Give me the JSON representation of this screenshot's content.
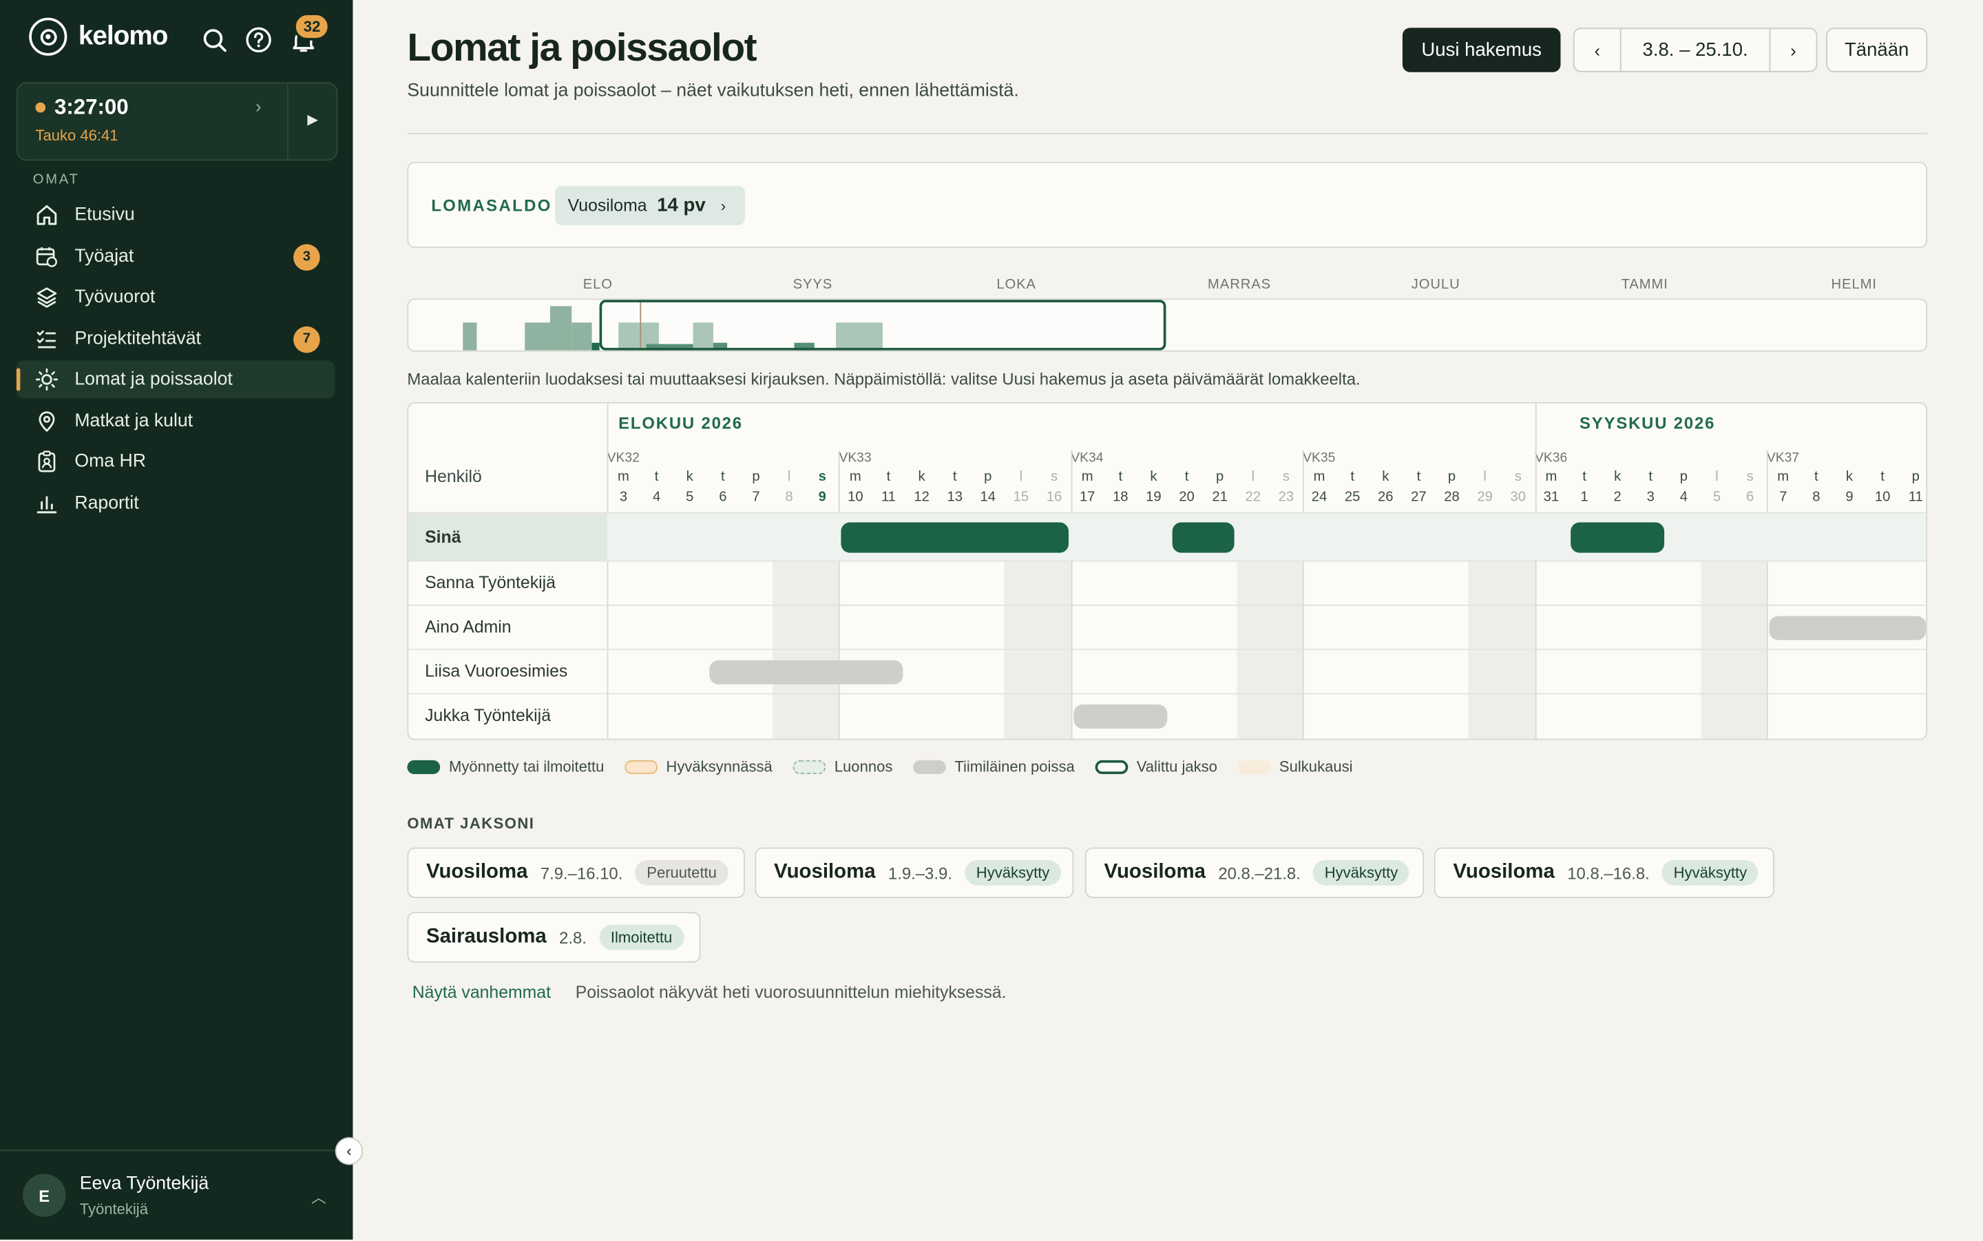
{
  "app": {
    "name": "kelomo",
    "notifications": "32"
  },
  "timer": {
    "time": "3:27:00",
    "pause": "Tauko 46:41"
  },
  "sidebar": {
    "section": "OMAT",
    "items": [
      {
        "label": "Etusivu",
        "icon": "home-icon"
      },
      {
        "label": "Työajat",
        "icon": "calendar-clock-icon",
        "badge": "3"
      },
      {
        "label": "Työvuorot",
        "icon": "layers-icon"
      },
      {
        "label": "Projektitehtävät",
        "icon": "checklist-icon",
        "badge": "7"
      },
      {
        "label": "Lomat ja poissaolot",
        "icon": "sun-icon",
        "active": true
      },
      {
        "label": "Matkat ja kulut",
        "icon": "map-pin-icon"
      },
      {
        "label": "Oma HR",
        "icon": "clipboard-icon"
      },
      {
        "label": "Raportit",
        "icon": "bar-chart-icon"
      }
    ]
  },
  "user": {
    "initial": "E",
    "name": "Eeva Työntekijä",
    "role": "Työntekijä"
  },
  "header": {
    "title": "Lomat ja poissaolot",
    "subtitle": "Suunnittele lomat ja poissaolot – näet vaikutuksen heti, ennen lähettämistä.",
    "new_button": "Uusi hakemus",
    "range": "3.8. – 25.10.",
    "today_button": "Tänään"
  },
  "balance": {
    "label": "LOMASALDO",
    "type": "Vuosiloma",
    "value": "14 pv"
  },
  "timeline": {
    "months": [
      "ELO",
      "SYYS",
      "LOKA",
      "MARRAS",
      "JOULU",
      "TAMMI",
      "HELMI"
    ]
  },
  "hint": "Maalaa kalenteriin luodaksesi tai muuttaaksesi kirjauksen. Näppäimistöllä: valitse Uusi hakemus ja aseta päivämäärät lomakkeelta.",
  "calendar": {
    "months": [
      "ELOKUU 2026",
      "SYYSKUU 2026"
    ],
    "person_header": "Henkilö",
    "weeks": [
      "VK32",
      "VK33",
      "VK34",
      "VK35",
      "VK36",
      "VK37"
    ],
    "days": [
      {
        "l": "m",
        "n": "3"
      },
      {
        "l": "t",
        "n": "4"
      },
      {
        "l": "k",
        "n": "5"
      },
      {
        "l": "t",
        "n": "6"
      },
      {
        "l": "p",
        "n": "7"
      },
      {
        "l": "l",
        "n": "8"
      },
      {
        "l": "s",
        "n": "9"
      },
      {
        "l": "m",
        "n": "10"
      },
      {
        "l": "t",
        "n": "11"
      },
      {
        "l": "k",
        "n": "12"
      },
      {
        "l": "t",
        "n": "13"
      },
      {
        "l": "p",
        "n": "14"
      },
      {
        "l": "l",
        "n": "15"
      },
      {
        "l": "s",
        "n": "16"
      },
      {
        "l": "m",
        "n": "17"
      },
      {
        "l": "t",
        "n": "18"
      },
      {
        "l": "k",
        "n": "19"
      },
      {
        "l": "t",
        "n": "20"
      },
      {
        "l": "p",
        "n": "21"
      },
      {
        "l": "l",
        "n": "22"
      },
      {
        "l": "s",
        "n": "23"
      },
      {
        "l": "m",
        "n": "24"
      },
      {
        "l": "t",
        "n": "25"
      },
      {
        "l": "k",
        "n": "26"
      },
      {
        "l": "t",
        "n": "27"
      },
      {
        "l": "p",
        "n": "28"
      },
      {
        "l": "l",
        "n": "29"
      },
      {
        "l": "s",
        "n": "30"
      },
      {
        "l": "m",
        "n": "31"
      },
      {
        "l": "t",
        "n": "1"
      },
      {
        "l": "k",
        "n": "2"
      },
      {
        "l": "t",
        "n": "3"
      },
      {
        "l": "p",
        "n": "4"
      },
      {
        "l": "l",
        "n": "5"
      },
      {
        "l": "s",
        "n": "6"
      },
      {
        "l": "m",
        "n": "7"
      },
      {
        "l": "t",
        "n": "8"
      },
      {
        "l": "k",
        "n": "9"
      },
      {
        "l": "t",
        "n": "10"
      },
      {
        "l": "p",
        "n": "11"
      }
    ],
    "rows": [
      {
        "name": "Sinä"
      },
      {
        "name": "Sanna Työntekijä"
      },
      {
        "name": "Aino Admin"
      },
      {
        "name": "Liisa Vuoroesimies"
      },
      {
        "name": "Jukka Työntekijä"
      }
    ]
  },
  "legend": [
    {
      "label": "Myönnetty tai ilmoitettu"
    },
    {
      "label": "Hyväksynnässä"
    },
    {
      "label": "Luonnos"
    },
    {
      "label": "Tiimiläinen poissa"
    },
    {
      "label": "Valittu jakso"
    },
    {
      "label": "Sulkukausi"
    }
  ],
  "own": {
    "label": "OMAT JAKSONI",
    "periods": [
      {
        "type": "Vuosiloma",
        "dates": "7.9.–16.10.",
        "status": "Peruutettu"
      },
      {
        "type": "Vuosiloma",
        "dates": "1.9.–3.9.",
        "status": "Hyväksytty"
      },
      {
        "type": "Vuosiloma",
        "dates": "20.8.–21.8.",
        "status": "Hyväksytty"
      },
      {
        "type": "Vuosiloma",
        "dates": "10.8.–16.8.",
        "status": "Hyväksytty"
      },
      {
        "type": "Sairausloma",
        "dates": "2.8.",
        "status": "Ilmoitettu"
      }
    ],
    "more": "Näytä vanhemmat",
    "note": "Poissaolot näkyvät heti vuorosuunnittelun miehityksessä."
  }
}
